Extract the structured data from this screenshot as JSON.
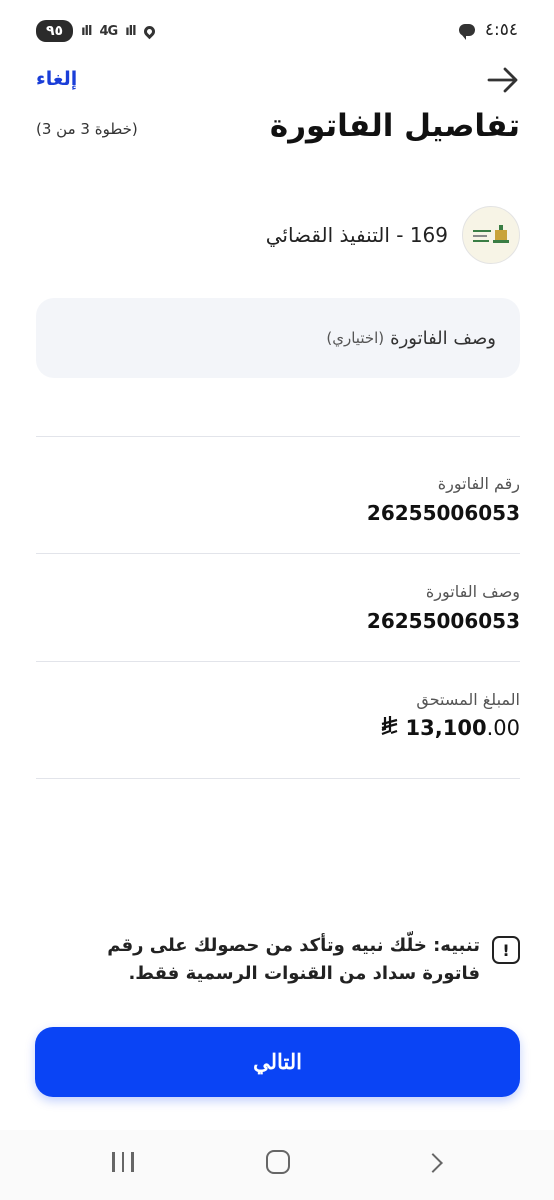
{
  "status_bar": {
    "time": "٤:٥٤",
    "battery": "٩٥",
    "network_label": "4G"
  },
  "header": {
    "cancel_label": "إلغاء",
    "title": "تفاصيل الفاتورة",
    "step_label": "(خطوة 3 من 3)"
  },
  "biller": {
    "name": "169 - التنفيذ القضائي",
    "logo_icon": "ministry-of-justice-logo"
  },
  "description_input": {
    "label": "وصف الفاتورة",
    "optional_label": "(اختياري)"
  },
  "fields": [
    {
      "label": "رقم الفاتورة",
      "value": "26255006053"
    },
    {
      "label": "وصف الفاتورة",
      "value": "26255006053"
    }
  ],
  "amount": {
    "label": "المبلغ المستحق",
    "integer_part": "13,100",
    "decimal_part": ".00",
    "currency_icon": "saudi-riyal-icon"
  },
  "warning": {
    "text": "تنبيه: خلّك نبيه وتأكد من حصولك على رقم فاتورة سداد من القنوات الرسمية فقط."
  },
  "next_button": {
    "label": "التالي"
  },
  "colors": {
    "accent": "#0a44f5",
    "link": "#1a3ed8"
  }
}
